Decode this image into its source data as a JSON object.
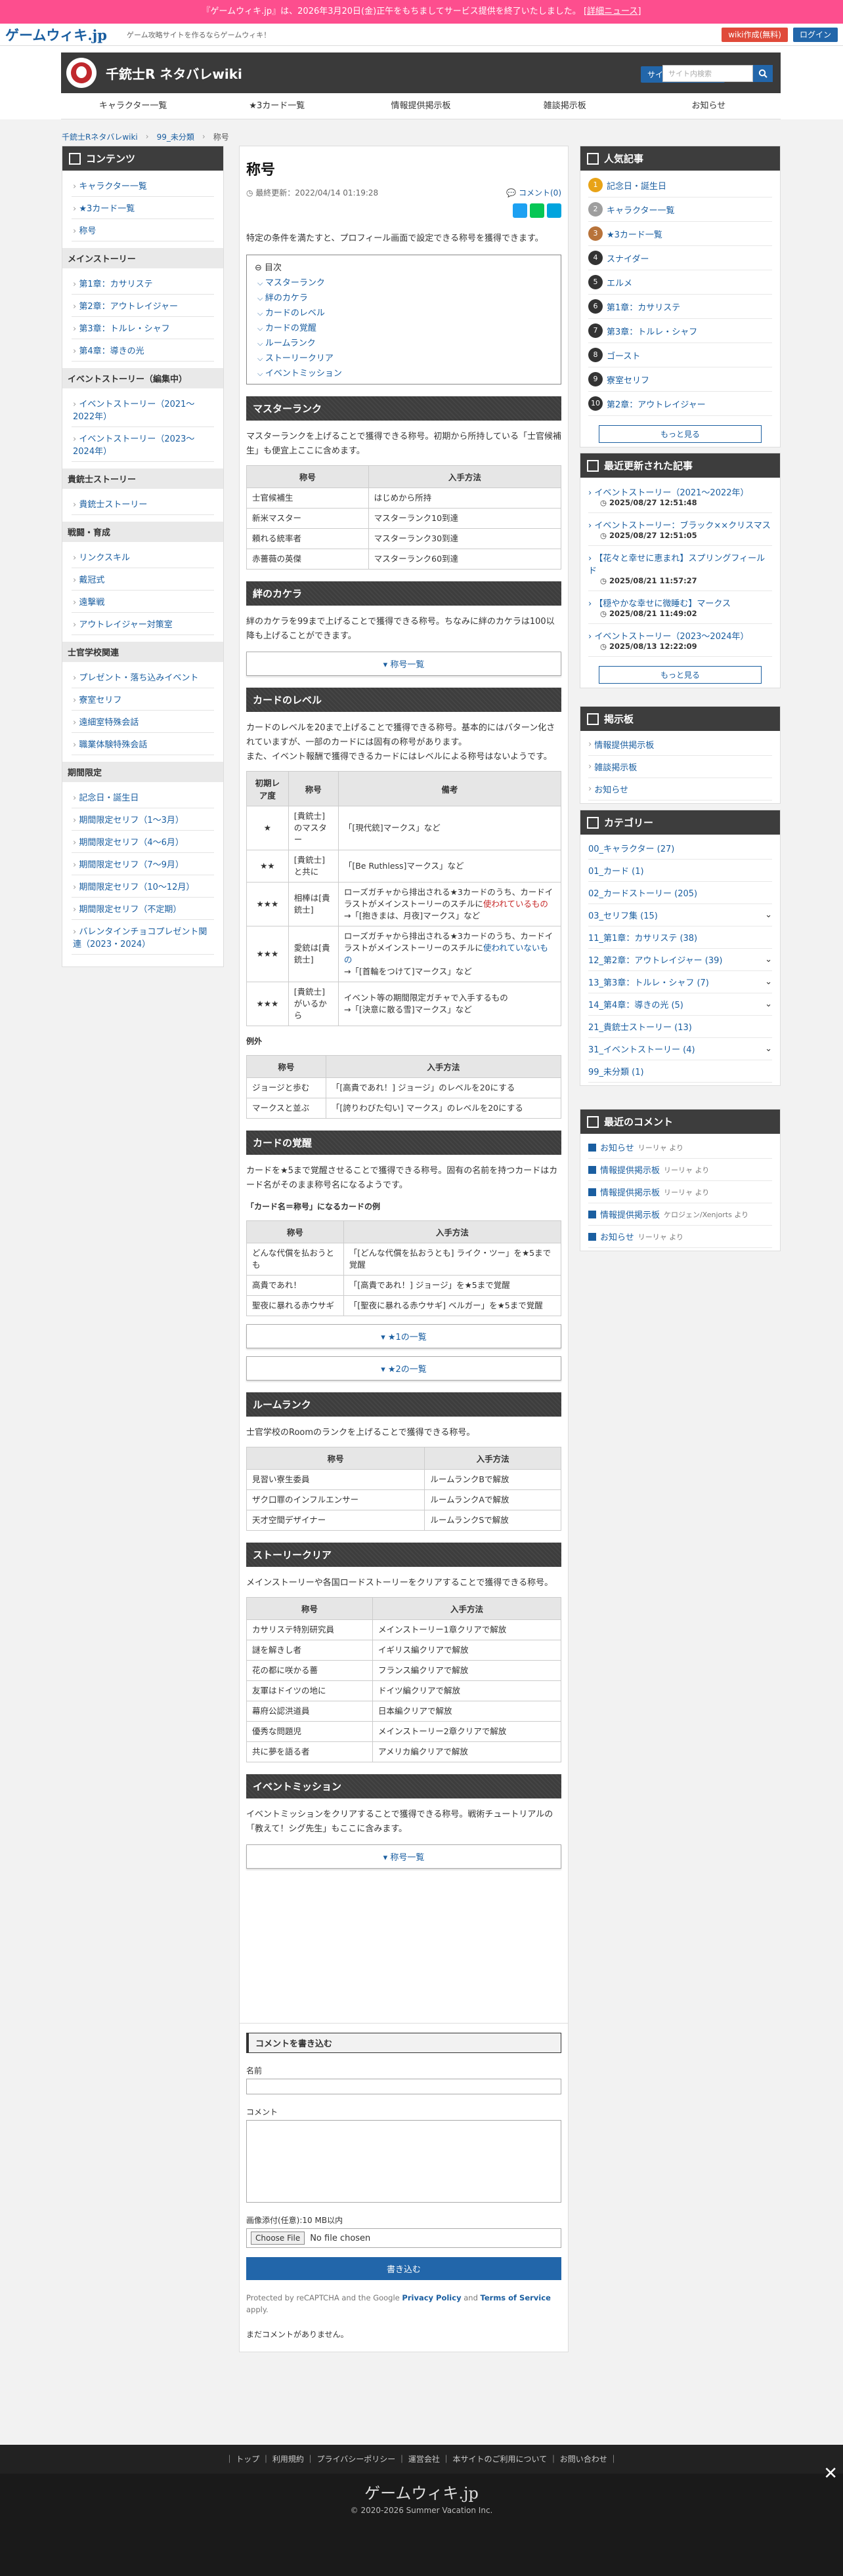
{
  "banner": {
    "text": "『ゲームウィキ.jp』は、2026年3月20日(金)正午をもちましてサービス提供を終了いたしました。",
    "link": "[詳細ニュース]"
  },
  "site": {
    "logo": "ゲームウィキ.jp",
    "tagline": "ゲーム攻略サイトを作るならゲームウィキ！",
    "btn_create": "wiki作成(無料)",
    "btn_login": "ログイン"
  },
  "wiki": {
    "title": "千銃士R ネタバレwiki",
    "join": "サイトの編集に参加",
    "search_placeholder": "サイト内検索"
  },
  "gnav": [
    "キャラクター一覧",
    "★3カード一覧",
    "情報提供掲示板",
    "雑談掲示板",
    "お知らせ"
  ],
  "breadcrumb": [
    "千銃士Rネタバレwiki",
    "99_未分類",
    "称号"
  ],
  "left": {
    "header": "コンテンツ",
    "top": [
      "キャラクター一覧",
      "★3カード一覧",
      "称号"
    ],
    "groups": [
      {
        "name": "メインストーリー",
        "items": [
          "第1章：カサリステ",
          "第2章：アウトレイジャー",
          "第3章：トルレ・シャフ",
          "第4章：導きの光"
        ]
      },
      {
        "name": "イベントストーリー（編集中）",
        "items": [
          "イベントストーリー（2021〜2022年）",
          "イベントストーリー（2023〜2024年）"
        ]
      },
      {
        "name": "貴銃士ストーリー",
        "items": [
          "貴銃士ストーリー"
        ]
      },
      {
        "name": "戦闘・育成",
        "items": [
          "リンクスキル",
          "戴冠式",
          "遠撃戦",
          "アウトレイジャー対策室"
        ]
      },
      {
        "name": "士官学校関連",
        "items": [
          "プレゼント・落ち込みイベント",
          "寮室セリフ",
          "遠細室特殊会話",
          "職業体験特殊会話"
        ]
      },
      {
        "name": "期間限定",
        "items": [
          "記念日・誕生日",
          "期間限定セリフ（1〜3月）",
          "期間限定セリフ（4〜6月）",
          "期間限定セリフ（7〜9月）",
          "期間限定セリフ（10〜12月）",
          "期間限定セリフ（不定期）",
          "バレンタインチョコプレゼント関連（2023・2024）"
        ]
      }
    ]
  },
  "article": {
    "title": "称号",
    "updated": "最終更新：2022/04/14 01:19:28",
    "comments": "コメント(0)",
    "lead": "特定の条件を満たすと、プロフィール画面で設定できる称号を獲得できます。",
    "toc_title": "目次",
    "toc": [
      "マスターランク",
      "絆のカケラ",
      "カードのレベル",
      "カードの覚醒",
      "ルームランク",
      "ストーリークリア",
      "イベントミッション"
    ],
    "s1": {
      "h": "マスターランク",
      "p": "マスターランクを上げることで獲得できる称号。初期から所持している「士官候補生」も便宜上ここに含めます。",
      "cols": [
        "称号",
        "入手方法"
      ],
      "rows": [
        [
          "士官候補生",
          "はじめから所持"
        ],
        [
          "新米マスター",
          "マスターランク10到達"
        ],
        [
          "頼れる統率者",
          "マスターランク30到達"
        ],
        [
          "赤薔薇の英傑",
          "マスターランク60到達"
        ]
      ]
    },
    "s2": {
      "h": "絆のカケラ",
      "p": "絆のカケラを99まで上げることで獲得できる称号。ちなみに絆のカケラは100以降も上げることができます。",
      "more": "称号一覧"
    },
    "s3": {
      "h": "カードのレベル",
      "p1": "カードのレベルを20まで上げることで獲得できる称号。基本的にはパターン化されていますが、一部のカードには固有の称号があります。",
      "p2": "また、イベント報酬で獲得できるカードにはレベルによる称号はないようです。",
      "cols": [
        "初期レア度",
        "称号",
        "備考"
      ],
      "rows": [
        [
          "★",
          "[貴銃士]のマスター",
          "「[現代銃]マークス」など"
        ],
        [
          "★★",
          "[貴銃士]と共に",
          "「[Be Ruthless]マークス」など"
        ],
        [
          "★★★",
          "相棒は[貴銃士]",
          "ローズガチャから排出される★3カードのうち、カードイラストがメインストーリーのスチルに",
          "使われているもの",
          "→「[抱きまは、月夜]マークス」など"
        ],
        [
          "★★★",
          "愛銃は[貴銃士]",
          "ローズガチャから排出される★3カードのうち、カードイラストがメインストーリーのスチルに",
          "使われていないもの",
          "→「[首輪をつけて]マークス」など"
        ],
        [
          "★★★",
          "[貴銃士]がいるから",
          "イベント等の期間限定ガチャで入手するもの",
          "",
          "→「[決意に散る雪]マークス」など"
        ]
      ],
      "ex_label": "例外",
      "ex_cols": [
        "称号",
        "入手方法"
      ],
      "ex_rows": [
        [
          "ジョージと歩む",
          "「[高貴であれ！] ジョージ」のレベルを20にする"
        ],
        [
          "マークスと並ぶ",
          "「[誇りわびた匂い] マークス」のレベルを20にする"
        ]
      ]
    },
    "s4": {
      "h": "カードの覚醒",
      "p": "カードを★5まで覚醒させることで獲得できる称号。固有の名前を持つカードはカード名がそのまま称号名になるようです。",
      "sub": "「カード名＝称号」になるカードの例",
      "cols": [
        "称号",
        "入手方法"
      ],
      "rows": [
        [
          "どんな代償を払おうとも",
          "「[どんな代償を払おうとも] ライク・ツー」を★5まで覚醒"
        ],
        [
          "高貴であれ！",
          "「[高貴であれ！] ジョージ」を★5まで覚醒"
        ],
        [
          "聖夜に暴れる赤ウサギ",
          "「[聖夜に暴れる赤ウサギ] ベルガー」を★5まで覚醒"
        ]
      ],
      "more1": "★1の一覧",
      "more2": "★2の一覧"
    },
    "s5": {
      "h": "ルームランク",
      "p": "士官学校のRoomのランクを上げることで獲得できる称号。",
      "cols": [
        "称号",
        "入手方法"
      ],
      "rows": [
        [
          "見習い寮生委員",
          "ルームランクBで解放"
        ],
        [
          "ザク口罪のインフルエンサー",
          "ルームランクAで解放"
        ],
        [
          "天才空間デザイナー",
          "ルームランクSで解放"
        ]
      ]
    },
    "s6": {
      "h": "ストーリークリア",
      "p": "メインストーリーや各国ロードストーリーをクリアすることで獲得できる称号。",
      "cols": [
        "称号",
        "入手方法"
      ],
      "rows": [
        [
          "カサリステ特別研究員",
          "メインストーリー1章クリアで解放"
        ],
        [
          "謎を解きし者",
          "イギリス編クリアで解放"
        ],
        [
          "花の都に咲かる薔",
          "フランス編クリアで解放"
        ],
        [
          "友軍はドイツの地に",
          "ドイツ編クリアで解放"
        ],
        [
          "幕府公認洪道員",
          "日本編クリアで解放"
        ],
        [
          "優秀な問題児",
          "メインストーリー2章クリアで解放"
        ],
        [
          "共に夢を語る者",
          "アメリカ編クリアで解放"
        ]
      ]
    },
    "s7": {
      "h": "イベントミッション",
      "p": "イベントミッションをクリアすることで獲得できる称号。戦術チュートリアルの「教えて！シグ先生」もここに含みます。",
      "more": "称号一覧"
    }
  },
  "comment_form": {
    "header": "コメントを書き込む",
    "name": "名前",
    "comment": "コメント",
    "image": "画像添付(任意):10 MB以内",
    "choose": "Choose File",
    "nofile": "No file chosen",
    "submit": "書き込む",
    "recaptcha_pre": "Protected by reCAPTCHA and the Google",
    "privacy": "Privacy Policy",
    "and": "and",
    "terms": "Terms of Service",
    "apply": "apply.",
    "none": "まだコメントがありません。"
  },
  "right": {
    "popular": {
      "header": "人気記事",
      "items": [
        "記念日・誕生日",
        "キャラクター一覧",
        "★3カード一覧",
        "スナイダー",
        "エルメ",
        "第1章：カサリステ",
        "第3章：トルレ・シャフ",
        "ゴースト",
        "寮室セリフ",
        "第2章：アウトレイジャー"
      ],
      "more": "もっと見る"
    },
    "recent": {
      "header": "最近更新された記事",
      "items": [
        [
          "イベントストーリー（2021〜2022年）",
          "2025/08/27 12:51:48"
        ],
        [
          "イベントストーリー：ブラック××クリスマス",
          "2025/08/27 12:51:05"
        ],
        [
          "【花々と幸せに恵まれ】スプリングフィールド",
          "2025/08/21 11:57:27"
        ],
        [
          "【穏やかな幸せに微睡む】マークス",
          "2025/08/21 11:49:02"
        ],
        [
          "イベントストーリー（2023〜2024年）",
          "2025/08/13 12:22:09"
        ]
      ],
      "more": "もっと見る"
    },
    "board": {
      "header": "掲示板",
      "items": [
        "情報提供掲示板",
        "雑談掲示板",
        "お知らせ"
      ]
    },
    "category": {
      "header": "カテゴリー",
      "items": [
        "00_キャラクター (27)",
        "01_カード (1)",
        "02_カードストーリー (205)",
        "03_セリフ集 (15)",
        "11_第1章：カサリステ (38)",
        "12_第2章：アウトレイジャー (39)",
        "13_第3章：トルレ・シャフ (7)",
        "14_第4章：導きの光 (5)",
        "21_貴銃士ストーリー (13)",
        "31_イベントストーリー (4)",
        "99_未分類 (1)"
      ]
    },
    "comments": {
      "header": "最近のコメント",
      "items": [
        [
          "お知らせ",
          "リーリャ より"
        ],
        [
          "情報提供掲示板",
          "リーリャ より"
        ],
        [
          "情報提供掲示板",
          "リーリャ より"
        ],
        [
          "情報提供掲示板",
          "ケロジェン/Xenjorts より"
        ],
        [
          "お知らせ",
          "リーリャ より"
        ]
      ]
    }
  },
  "footer": {
    "links": "｜ トップ ｜ 利用規約 ｜ プライバシーポリシー ｜ 運営会社 ｜ 本サイトのご利用について ｜ お問い合わせ ｜",
    "logo": "ゲームウィキ.jp",
    "copy": "© 2020-2026 Summer Vacation Inc."
  },
  "colors": {
    "banner": "#fd4e8e",
    "accent": "#1a5ea0",
    "dark": "#3d3d3d"
  }
}
